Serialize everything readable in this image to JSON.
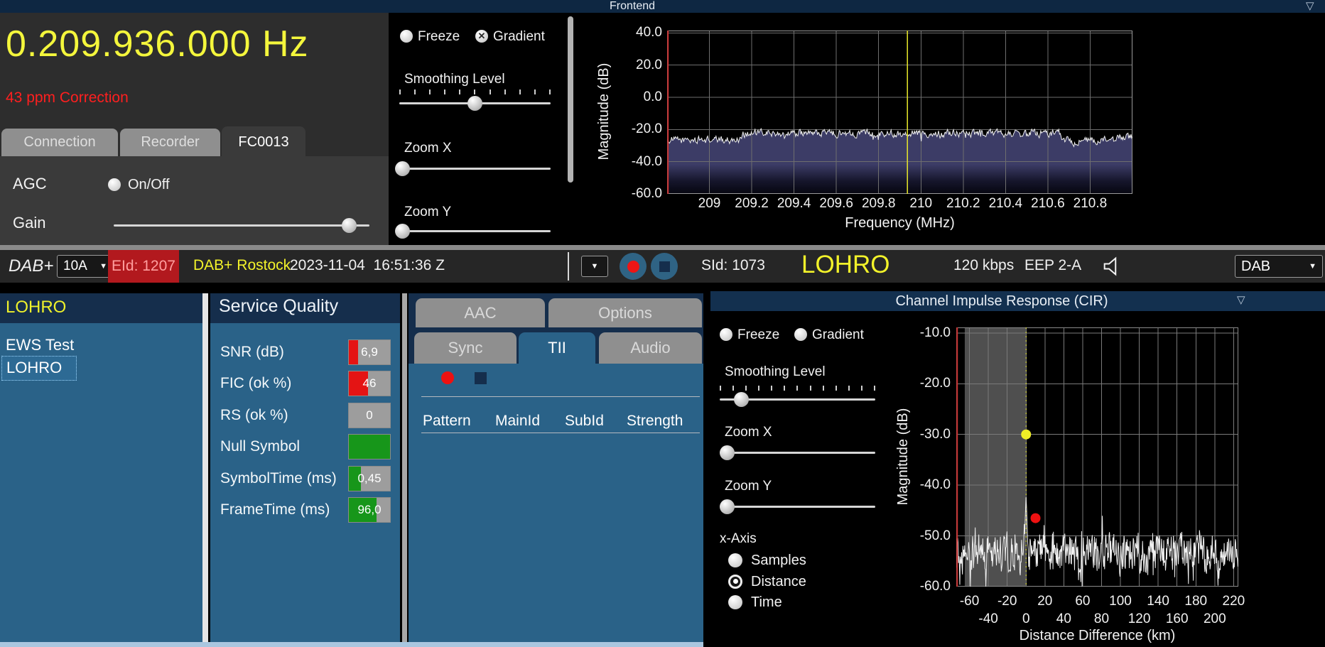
{
  "icons": {
    "dropdown_arrow": "▼",
    "collapse_triangle": "▽",
    "checked_cross": "✕"
  },
  "frontend": {
    "title": "Frontend",
    "frequency_display": "0.209.936.000 Hz",
    "correction": "43 ppm Correction",
    "tabs": [
      "Connection",
      "Recorder",
      "FC0013"
    ],
    "active_tab": "FC0013",
    "agc_label": "AGC",
    "agc_toggle_label": "On/Off",
    "gain_label": "Gain",
    "controls": {
      "freeze": "Freeze",
      "gradient": "Gradient",
      "smoothing": "Smoothing Level",
      "zoom_x": "Zoom X",
      "zoom_y": "Zoom Y",
      "freeze_checked": false,
      "gradient_checked": true,
      "smoothing_percent": 50,
      "zoom_x_percent": 2,
      "zoom_y_percent": 2,
      "gain_percent": 92
    }
  },
  "status_bar": {
    "mode": "DAB+",
    "channel": "10A",
    "ensemble_id": "EId: 1207",
    "ensemble_name": "DAB+ Rostock",
    "datetime": "2023-11-04  16:51:36 Z",
    "service_id": "SId: 1073",
    "service_name": "LOHRO",
    "bitrate": "120 kbps",
    "protection": "EEP 2-A",
    "output_selector": "DAB"
  },
  "services": {
    "header": "LOHRO",
    "items": [
      "EWS Test",
      "LOHRO"
    ],
    "selected": "LOHRO"
  },
  "service_quality": {
    "header": "Service Quality",
    "metrics": [
      {
        "label": "SNR (dB)",
        "value": "6,9",
        "fill_percent": 22,
        "bar_color": "#e41414"
      },
      {
        "label": "FIC (ok %)",
        "value": "46",
        "fill_percent": 46,
        "bar_color": "#e41414"
      },
      {
        "label": "RS (ok %)",
        "value": "0",
        "fill_percent": 0,
        "bar_color": "#e41414"
      },
      {
        "label": "Null Symbol",
        "value": "",
        "fill_percent": 100,
        "bar_color": "#17961a"
      },
      {
        "label": "SymbolTime (ms)",
        "value": "0,45",
        "fill_percent": 30,
        "bar_color": "#17961a"
      },
      {
        "label": "FrameTime (ms)",
        "value": "96,0",
        "fill_percent": 68,
        "bar_color": "#17961a"
      }
    ]
  },
  "details": {
    "tabs_top": [
      "AAC",
      "Options"
    ],
    "tabs_bottom": [
      "Sync",
      "TII",
      "Audio"
    ],
    "active_bottom_tab": "TII",
    "tii_columns": [
      "Pattern",
      "MainId",
      "SubId",
      "Strength"
    ]
  },
  "cir": {
    "title": "Channel Impulse Response (CIR)",
    "controls": {
      "freeze": "Freeze",
      "gradient": "Gradient",
      "smoothing": "Smoothing Level",
      "zoom_x": "Zoom X",
      "zoom_y": "Zoom Y",
      "freeze_checked": false,
      "gradient_checked": false,
      "smoothing_percent": 14,
      "zoom_x_percent": 5,
      "zoom_y_percent": 5
    },
    "x_axis_label": "x-Axis",
    "x_axis_options": [
      "Samples",
      "Distance",
      "Time"
    ],
    "x_axis_selected": "Distance"
  },
  "chart_data": [
    {
      "name": "frontend-spectrum",
      "type": "line",
      "title": "Frontend",
      "xlabel": "Frequency (MHz)",
      "ylabel": "Magnitude (dB)",
      "xlim": [
        208.8,
        211.0
      ],
      "ylim": [
        -60,
        41.5
      ],
      "x_ticks": [
        209,
        209.2,
        209.4,
        209.6,
        209.8,
        210,
        210.2,
        210.4,
        210.6,
        210.8
      ],
      "x_tick_labels": [
        "209",
        "209.2",
        "209.4",
        "209.6",
        "209.8",
        "210",
        "210.2",
        "210.4",
        "210.6",
        "210.8"
      ],
      "y_ticks": [
        40,
        20,
        0,
        -20,
        -40,
        -60
      ],
      "y_tick_labels": [
        "40.0",
        "20.0",
        "0.0",
        "-20.0",
        "-40.0",
        "-60.0"
      ],
      "grid": true,
      "legend": "none",
      "tuned_marker_mhz": 209.936,
      "marker_color": "#e8e82a",
      "left_edge_line_color": "#c93030",
      "series": [
        {
          "name": "spectrum-noise-floor",
          "segments": [
            {
              "from_mhz": 208.8,
              "to_mhz": 209.15,
              "level_db": -26.5
            },
            {
              "from_mhz": 209.15,
              "to_mhz": 210.67,
              "level_db": -22.3
            },
            {
              "from_mhz": 210.67,
              "to_mhz": 210.93,
              "level_db": -27.0
            },
            {
              "from_mhz": 210.93,
              "to_mhz": 211.0,
              "level_db": -24.5
            }
          ],
          "noise_db": 2.2
        }
      ]
    },
    {
      "name": "channel-impulse-response",
      "type": "line",
      "title": "Channel Impulse Response (CIR)",
      "xlabel": "Distance Difference (km)",
      "ylabel": "Magnitude (dB)",
      "xlim": [
        -74,
        225
      ],
      "ylim": [
        -60,
        -8.9
      ],
      "x_ticks_row1": [
        -60,
        -20,
        20,
        60,
        100,
        140,
        180,
        220
      ],
      "x_tick_labels_row1": [
        "-60",
        "-20",
        "20",
        "60",
        "100",
        "140",
        "180",
        "220"
      ],
      "x_ticks_row2": [
        -40,
        0,
        40,
        80,
        120,
        160,
        200
      ],
      "x_tick_labels_row2": [
        "-40",
        "0",
        "40",
        "80",
        "120",
        "160",
        "200"
      ],
      "x_grid_step_km": 20,
      "y_ticks": [
        -10,
        -20,
        -30,
        -40,
        -50,
        -60
      ],
      "y_tick_labels": [
        "-10.0",
        "-20.0",
        "-30.0",
        "-40.0",
        "-50.0",
        "-60.0"
      ],
      "grid": true,
      "noise_floor_db": -53.5,
      "noise_db": 3.4,
      "main_peak": {
        "x_km": 0,
        "top_db": -42
      },
      "markers": [
        {
          "name": "main-path-marker",
          "x_km": 0,
          "db": -30,
          "color": "#f0ee26"
        },
        {
          "name": "echo-marker",
          "x_km": 10,
          "db": -46.5,
          "color": "#ee1111"
        }
      ],
      "shaded_region_km": [
        -65,
        0
      ],
      "guide_line_km": 0
    }
  ]
}
